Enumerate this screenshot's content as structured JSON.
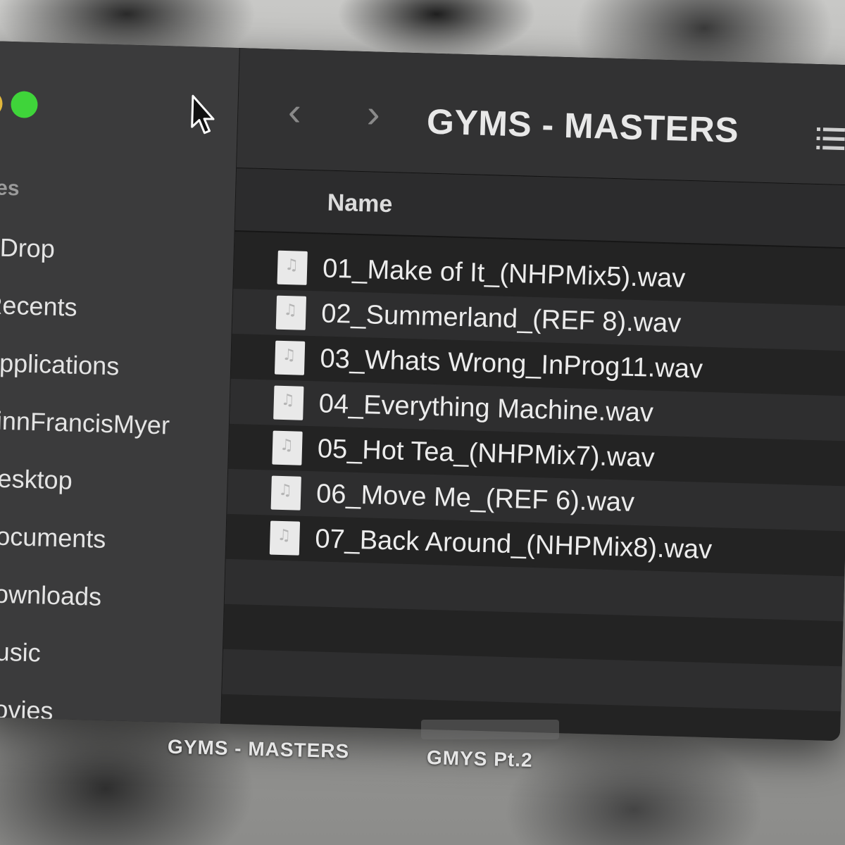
{
  "sidebar": {
    "section_title": "tes",
    "items": [
      {
        "label": "irDrop",
        "icon": "airdrop-icon"
      },
      {
        "label": "Recents",
        "icon": "clock-icon"
      },
      {
        "label": "Applications",
        "icon": "applications-icon"
      },
      {
        "label": "FinnFrancisMyer",
        "icon": "home-icon"
      },
      {
        "label": "Desktop",
        "icon": "desktop-icon"
      },
      {
        "label": "Documents",
        "icon": "document-icon"
      },
      {
        "label": "Downloads",
        "icon": "download-icon"
      },
      {
        "label": "Music",
        "icon": "music-icon"
      },
      {
        "label": "Movies",
        "icon": "movies-icon"
      }
    ]
  },
  "toolbar": {
    "title": "GYMS - MASTERS",
    "back_icon": "‹",
    "forward_icon": "›"
  },
  "list": {
    "column_name": "Name",
    "files": [
      "01_Make of It_(NHPMix5).wav",
      "02_Summerland_(REF 8).wav",
      "03_Whats Wrong_InProg11.wav",
      "04_Everything Machine.wav",
      "05_Hot Tea_(NHPMix7).wav",
      "06_Move Me_(REF 6).wav",
      "07_Back Around_(NHPMix8).wav"
    ]
  },
  "desktop": {
    "folder_1": "GYMS - MASTERS",
    "folder_2": "GMYS Pt.2"
  },
  "colors": {
    "close_yellow": "#e2b83c",
    "zoom_green": "#3fd43a",
    "sidebar_bg": "#3b3b3c",
    "toolbar_bg": "#323233",
    "list_bg": "#232323"
  }
}
